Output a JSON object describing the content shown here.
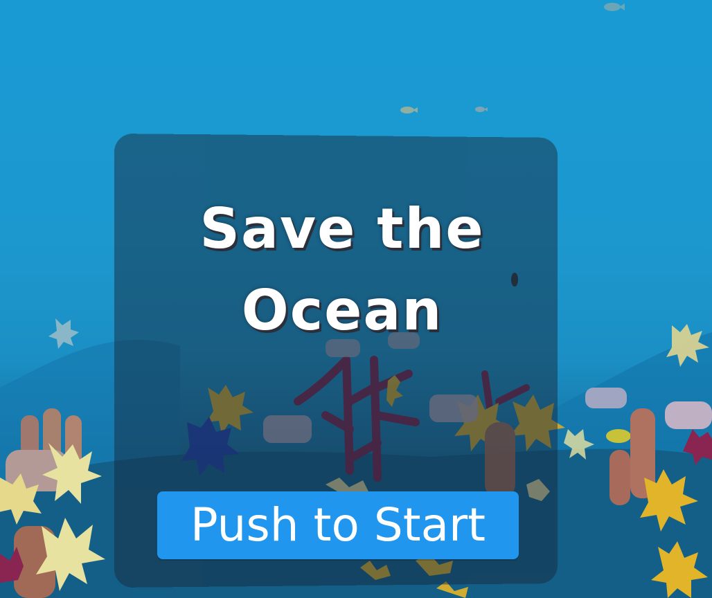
{
  "game": {
    "title": "Save the\nOcean",
    "start_button_label": "Push to Start"
  },
  "colors": {
    "water": "#1a9ad3",
    "panel": "#16283a",
    "button": "#2196ee",
    "coral_yellow": "#e2b42a",
    "coral_cream": "#e8e2a0",
    "coral_purple": "#8a2450",
    "coral_blue": "#1f3fae",
    "coral_salmon": "#b06a58"
  }
}
